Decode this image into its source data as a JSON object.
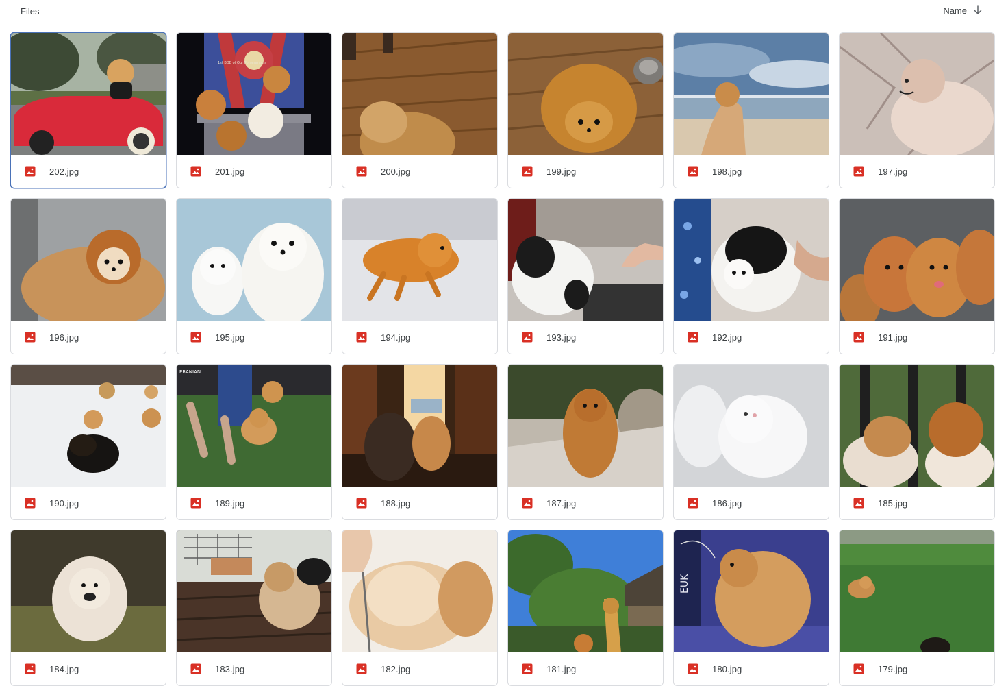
{
  "header": {
    "title": "Files",
    "sort_label": "Name",
    "sort_icon": "arrow-down-icon"
  },
  "colors": {
    "image_icon": "#d93025",
    "selected_border": "#4a72b8",
    "card_border": "#dadce0"
  },
  "thumb_text": {
    "show_banner": "1st BOB of Our Pomeranians",
    "show_banner_2": "ERANIAN",
    "show_banner_3": "EUK"
  },
  "files": [
    {
      "name": "202.jpg",
      "selected": true
    },
    {
      "name": "201.jpg"
    },
    {
      "name": "200.jpg"
    },
    {
      "name": "199.jpg"
    },
    {
      "name": "198.jpg"
    },
    {
      "name": "197.jpg"
    },
    {
      "name": "196.jpg"
    },
    {
      "name": "195.jpg"
    },
    {
      "name": "194.jpg"
    },
    {
      "name": "193.jpg"
    },
    {
      "name": "192.jpg"
    },
    {
      "name": "191.jpg"
    },
    {
      "name": "190.jpg"
    },
    {
      "name": "189.jpg"
    },
    {
      "name": "188.jpg"
    },
    {
      "name": "187.jpg"
    },
    {
      "name": "186.jpg"
    },
    {
      "name": "185.jpg"
    },
    {
      "name": "184.jpg"
    },
    {
      "name": "183.jpg"
    },
    {
      "name": "182.jpg"
    },
    {
      "name": "181.jpg"
    },
    {
      "name": "180.jpg"
    },
    {
      "name": "179.jpg"
    }
  ]
}
